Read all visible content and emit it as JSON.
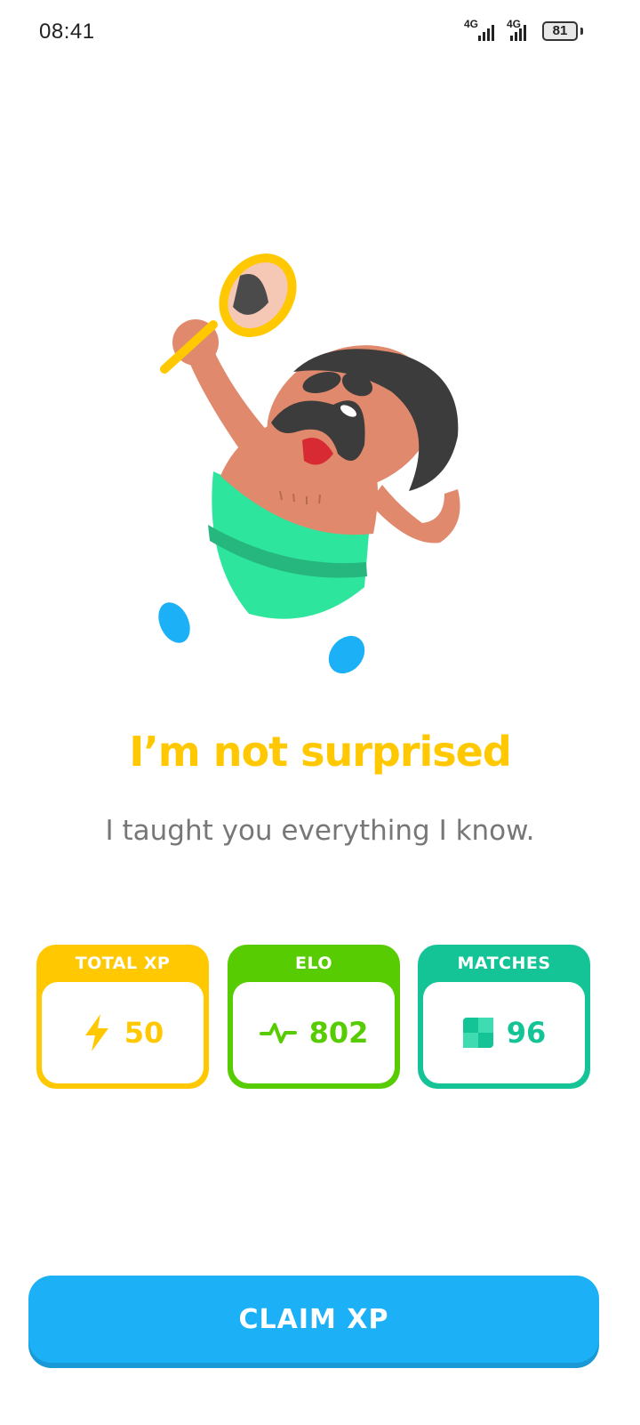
{
  "status_bar": {
    "time": "08:41",
    "network_1": "4G",
    "network_2": "4G",
    "battery": "81"
  },
  "headline": "I’m not surprised",
  "subtitle": "I taught you everything I know.",
  "stats": [
    {
      "title": "TOTAL XP",
      "value": "50",
      "icon": "lightning-icon",
      "color": "#ffc800"
    },
    {
      "title": "ELO",
      "value": "802",
      "icon": "pulse-icon",
      "color": "#58cc02"
    },
    {
      "title": "MATCHES",
      "value": "96",
      "icon": "grid-square-icon",
      "color": "#14c496"
    }
  ],
  "claim_button": {
    "label": "CLAIM XP",
    "color": "#1cb0f6"
  }
}
